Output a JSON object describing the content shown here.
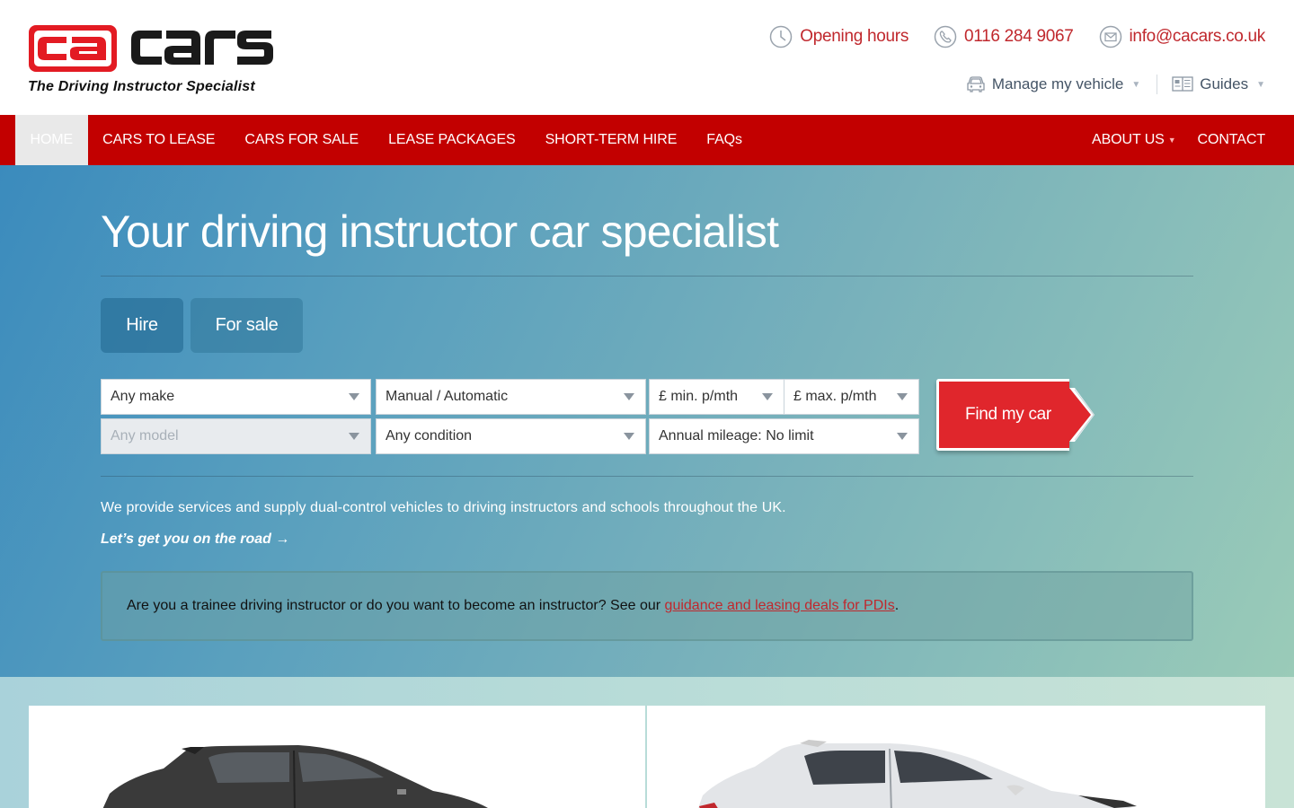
{
  "brand": {
    "logo_text": "cacars",
    "tagline": "The Driving Instructor Specialist",
    "accent": "#c20000"
  },
  "header": {
    "opening_hours": "Opening hours",
    "phone": "0116 284 9067",
    "email": "info@cacars.co.uk",
    "manage_vehicle": "Manage my vehicle",
    "guides": "Guides"
  },
  "nav": {
    "items": [
      {
        "label": "HOME",
        "active": true
      },
      {
        "label": "CARS TO LEASE"
      },
      {
        "label": "CARS FOR SALE"
      },
      {
        "label": "LEASE PACKAGES"
      },
      {
        "label": "SHORT-TERM HIRE"
      },
      {
        "label": "FAQs"
      }
    ],
    "about": "ABOUT US",
    "contact": "CONTACT"
  },
  "hero": {
    "title": "Your driving instructor car specialist",
    "tabs": [
      "Hire",
      "For sale"
    ],
    "search": {
      "make": "Any make",
      "transmission": "Manual / Automatic",
      "min_price": "£ min. p/mth",
      "max_price": "£ max. p/mth",
      "model": "Any model",
      "condition": "Any condition",
      "mileage": "Annual mileage: No limit",
      "submit": "Find my car"
    },
    "intro": "We provide services and supply dual-control vehicles to driving instructors and schools throughout the UK.",
    "cta": "Let’s get you on the road →",
    "info_prefix": "Are you a trainee driving instructor or do you want to become an instructor? See our ",
    "info_link": "guidance and leasing deals for PDIs",
    "info_suffix": "."
  }
}
